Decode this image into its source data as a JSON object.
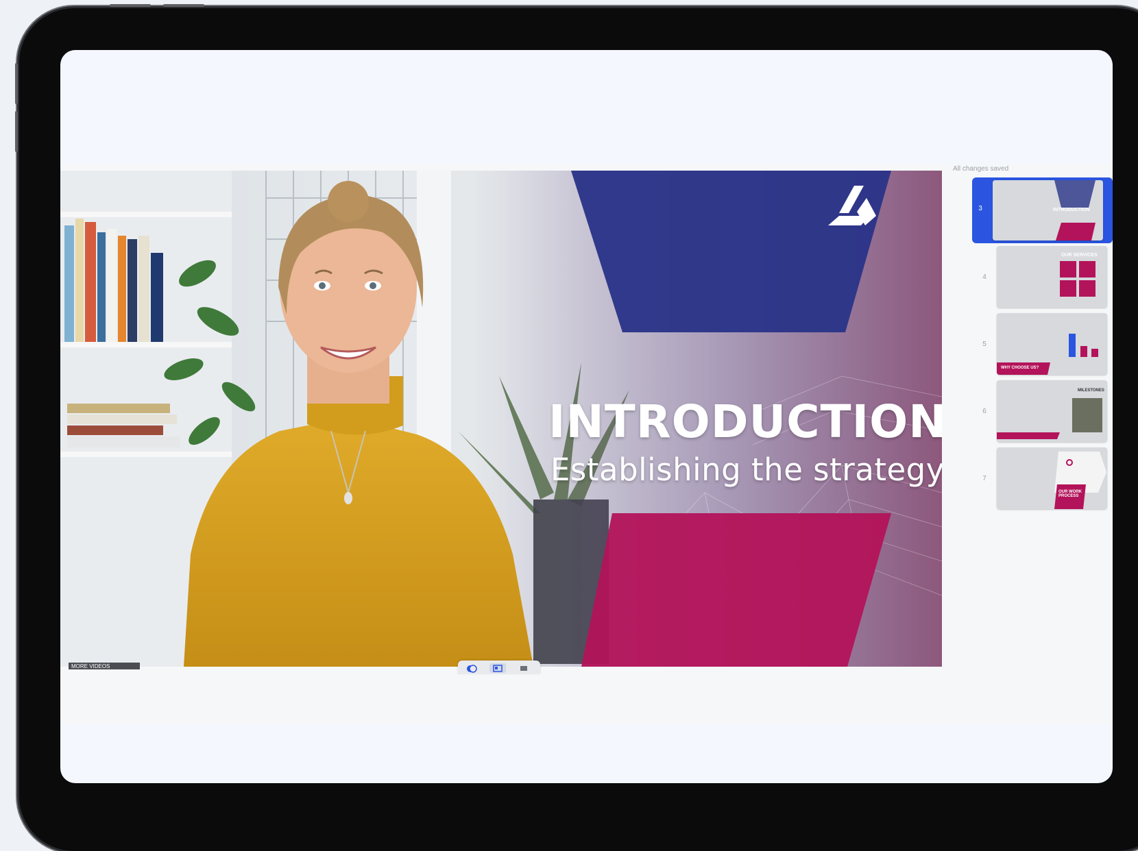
{
  "app": {
    "save_status": "All changes saved",
    "more_videos_label": "MORE VIDEOS"
  },
  "slide": {
    "title": "INTRODUCTION",
    "subtitle": "Establishing the strategy"
  },
  "slide_thumbnails": [
    {
      "number": "3",
      "title": "INTRODUCTION",
      "active": true
    },
    {
      "number": "4",
      "title": "OUR SERVICES",
      "active": false
    },
    {
      "number": "5",
      "title": "WHY CHOOSE US?",
      "active": false
    },
    {
      "number": "6",
      "title": "MILESTONES",
      "active": false
    },
    {
      "number": "7",
      "title": "OUR WORK PROCESS",
      "active": false
    }
  ],
  "colors": {
    "accent_blue": "#2b55e0",
    "slide_navy": "#2b3588",
    "slide_crimson": "#b3135a",
    "presenter_sweater": "#d7a21f"
  },
  "icons": {
    "logo": "triangle-logo-icon",
    "controls": [
      "camera-toggle-icon",
      "layout-icon",
      "stop-icon"
    ]
  }
}
